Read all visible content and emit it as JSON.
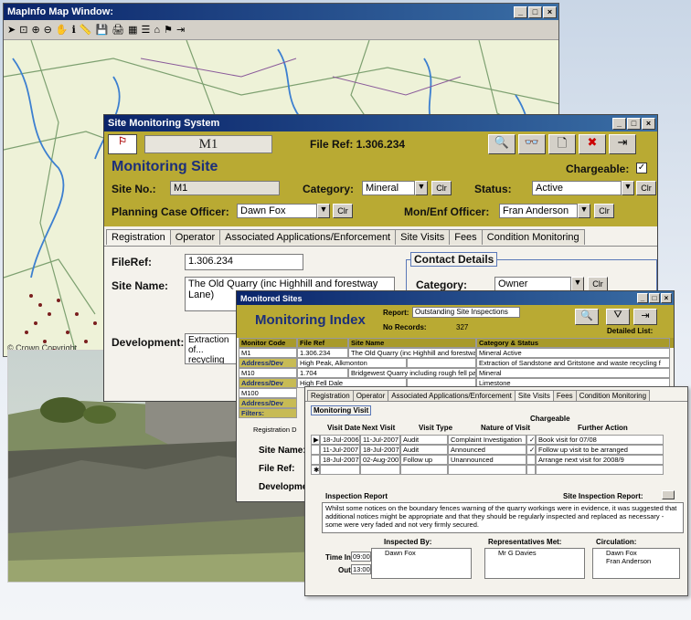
{
  "mapinfo": {
    "title": "MapInfo Map Window:",
    "copyright": "© Crown Copyright"
  },
  "sms": {
    "title": "Site Monitoring System",
    "site_code": "M1",
    "file_ref_header": "File Ref: 1.306.234",
    "heading": "Monitoring Site",
    "chargeable_label": "Chargeable:",
    "site_no_label": "Site No.:",
    "site_no": "M1",
    "category_label": "Category:",
    "category": "Mineral",
    "status_label": "Status:",
    "status": "Active",
    "planning_officer_label": "Planning Case Officer:",
    "planning_officer": "Dawn Fox",
    "mon_officer_label": "Mon/Enf Officer:",
    "mon_officer": "Fran Anderson",
    "clr": "Clr",
    "tabs": [
      "Registration",
      "Operator",
      "Associated Applications/Enforcement",
      "Site Visits",
      "Fees",
      "Condition Monitoring"
    ],
    "fileref_label": "FileRef:",
    "fileref": "1.306.234",
    "site_name_label": "Site Name:",
    "site_name": "The Old Quarry (inc Highhill and forestway Lane)",
    "development_label": "Development:",
    "development": "Extraction of... recycling fac...",
    "contact_details": "Contact Details",
    "contact_category_label": "Category:",
    "contact_category": "Owner"
  },
  "monitored": {
    "title": "Monitored Sites",
    "heading": "Monitoring Index",
    "report_label": "Report:",
    "report": "Outstanding Site Inspections",
    "no_records_label": "No Records:",
    "no_records": "327",
    "detailed_list": "Detailed List:",
    "columns": [
      "Monitor Code",
      "File Ref",
      "Site Name",
      "Category & Status"
    ],
    "rows": [
      {
        "code": "M1",
        "file": "1.306.234",
        "name": "The Old Quarry (inc Highhill and forestway Lane)",
        "cat": "Mineral Active"
      },
      {
        "code": "Address/Dev",
        "file": "High Peak, Alkmonton",
        "name": "",
        "cat": "Extraction of Sandstone and Gritstone and waste recycling f"
      },
      {
        "code": "M10",
        "file": "1.704",
        "name": "Bridgewest Quarry including rough fell pasture",
        "cat": "Mineral"
      },
      {
        "code": "Address/Dev",
        "file": "High Fell Dale",
        "name": "",
        "cat": "Limestone"
      },
      {
        "code": "M100",
        "file": "",
        "name": "",
        "cat": ""
      },
      {
        "code": "Address/Dev",
        "file": "",
        "name": "",
        "cat": ""
      }
    ],
    "filters": "Filters:",
    "side_labels": [
      "Registration D",
      "Site Name:",
      "File Ref:",
      "Developme"
    ]
  },
  "visits": {
    "tabs": [
      "Registration",
      "Operator",
      "Associated Applications/Enforcement",
      "Site Visits",
      "Fees",
      "Condition Monitoring"
    ],
    "section": "Monitoring Visit",
    "chargeable": "Chargeable",
    "columns": [
      "Visit Date",
      "Next Visit",
      "Visit Type",
      "Nature of Visit",
      "Further Action"
    ],
    "rows": [
      {
        "date": "18-Jul-2006",
        "next": "11-Jul-2007",
        "type": "Audit",
        "nature": "Complaint Investigation",
        "action": "Book visit for 07/08"
      },
      {
        "date": "11-Jul-2007",
        "next": "18-Jul-2007",
        "type": "Audit",
        "nature": "Announced",
        "action": "Follow up visit to be arranged"
      },
      {
        "date": "18-Jul-2007",
        "next": "02-Aug-2007",
        "type": "Follow up",
        "nature": "Unannounced",
        "action": "Arrange next visit for 2008/9"
      }
    ],
    "inspection_report": "Inspection Report",
    "site_inspection_report": "Site Inspection Report:",
    "report_text": "Whilst some notices on the boundary fences warning of the quarry workings were in evidence, it was suggested that additional notices might be appropriate and that they should be regularly inspected and replaced as necessary - some were very faded and not very firmly secured.",
    "inspected_by_label": "Inspected By:",
    "inspected_by": "Dawn Fox",
    "reps_label": "Representatives Met:",
    "reps": "Mr G Davies",
    "circulation_label": "Circulation:",
    "circulation": [
      "Dawn Fox",
      "Fran Anderson"
    ],
    "time_in_label": "Time In",
    "time_in": "09:00",
    "out_label": "Out",
    "out": "13:00"
  },
  "colors": {
    "olive": "#b9aa33",
    "titlebar": "#0a246a"
  }
}
